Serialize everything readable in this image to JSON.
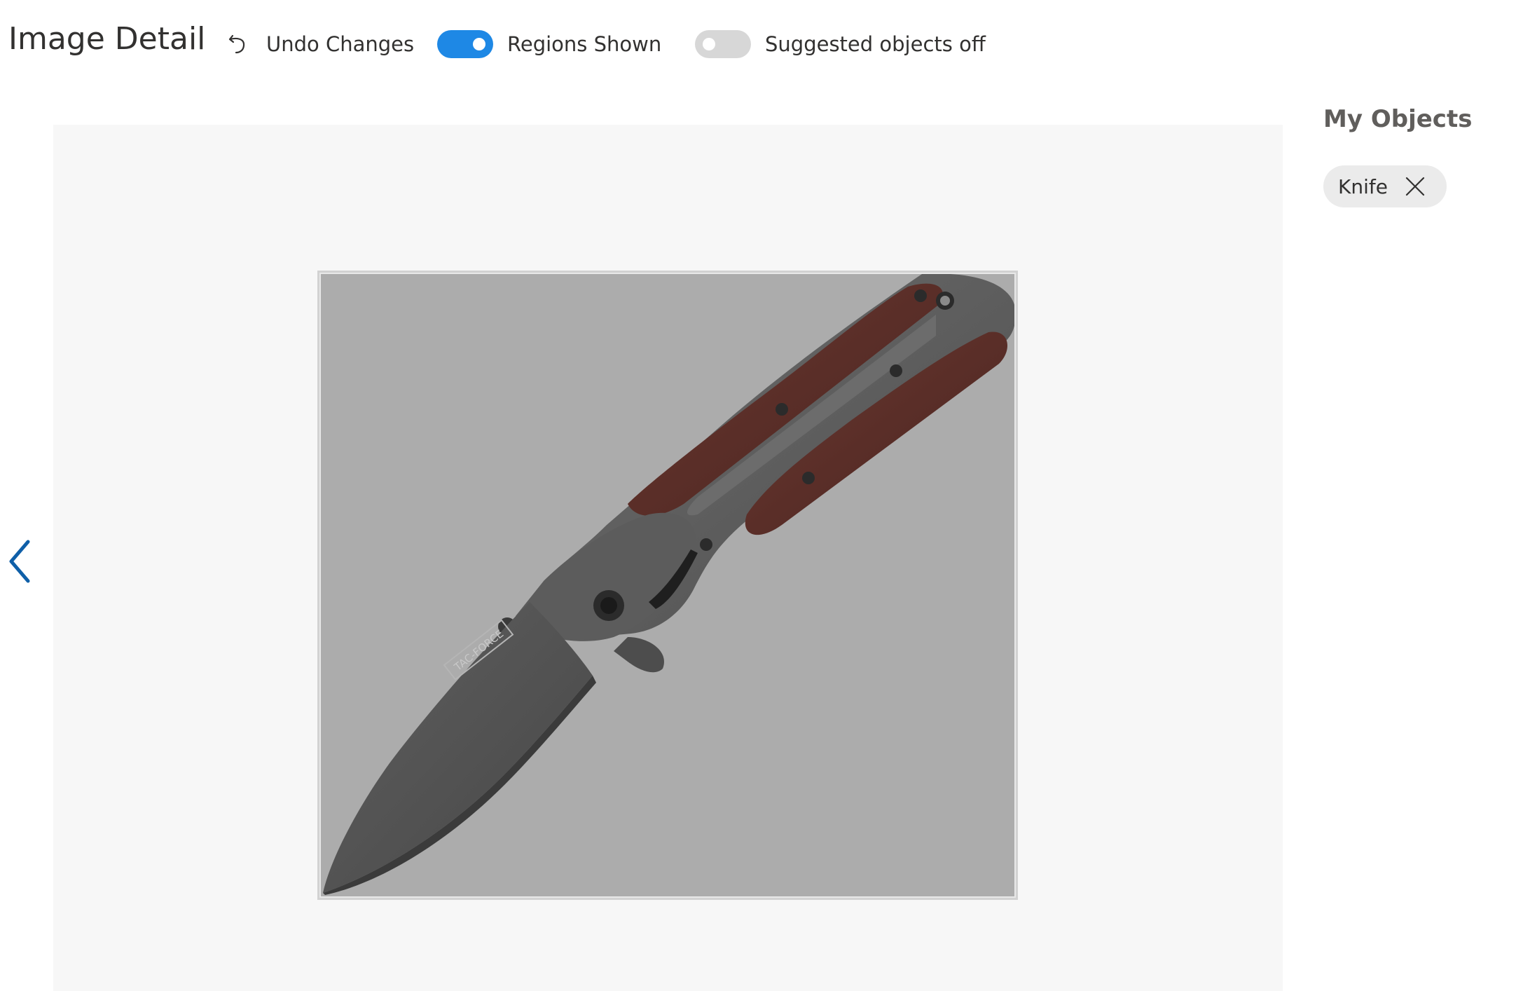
{
  "header": {
    "title": "Image Detail",
    "undo": {
      "label": "Undo Changes",
      "icon": "undo-icon"
    },
    "regions_toggle": {
      "label": "Regions Shown",
      "state": "on"
    },
    "suggested_toggle": {
      "label": "Suggested objects off",
      "state": "off"
    }
  },
  "navigation": {
    "previous_icon": "chevron-left-icon"
  },
  "image": {
    "subject": "folding knife",
    "blade_text": "TAC-FORCE",
    "region_selected": true
  },
  "side_panel": {
    "title": "My Objects",
    "tags": [
      {
        "label": "Knife",
        "remove_icon": "close-icon"
      }
    ]
  },
  "colors": {
    "accent": "#1e88e5",
    "nav_chevron": "#0f5fa8",
    "canvas_background": "#f7f7f7",
    "image_background": "#acacac"
  }
}
